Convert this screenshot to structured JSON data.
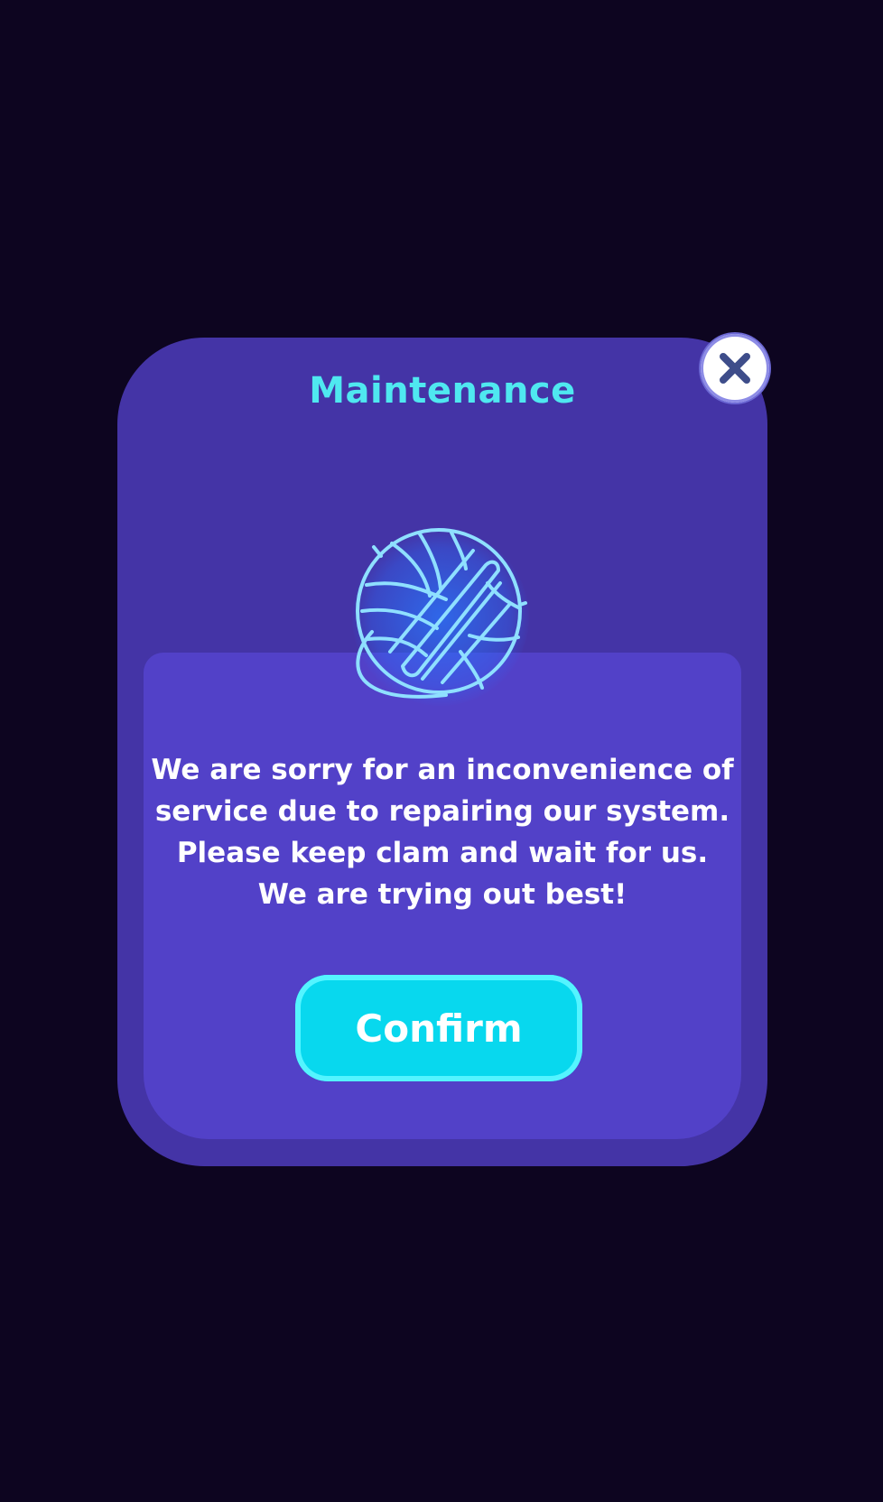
{
  "dialog": {
    "title": "Maintenance",
    "icon": "yarn-ball-icon",
    "message_lines": [
      "We are sorry for an inconvenience of",
      "service due to repairing our system.",
      "Please keep clam and wait for us.",
      "We are trying out best!"
    ],
    "confirm_label": "Confirm",
    "close_icon": "close-icon"
  },
  "colors": {
    "background": "#0d0520",
    "dialog": "#4434a6",
    "panel": "#5241c8",
    "title": "#4fe8f0",
    "button": "#08d8ee",
    "button_border": "#54f4ff",
    "icon_glow": "#2f7dff"
  }
}
